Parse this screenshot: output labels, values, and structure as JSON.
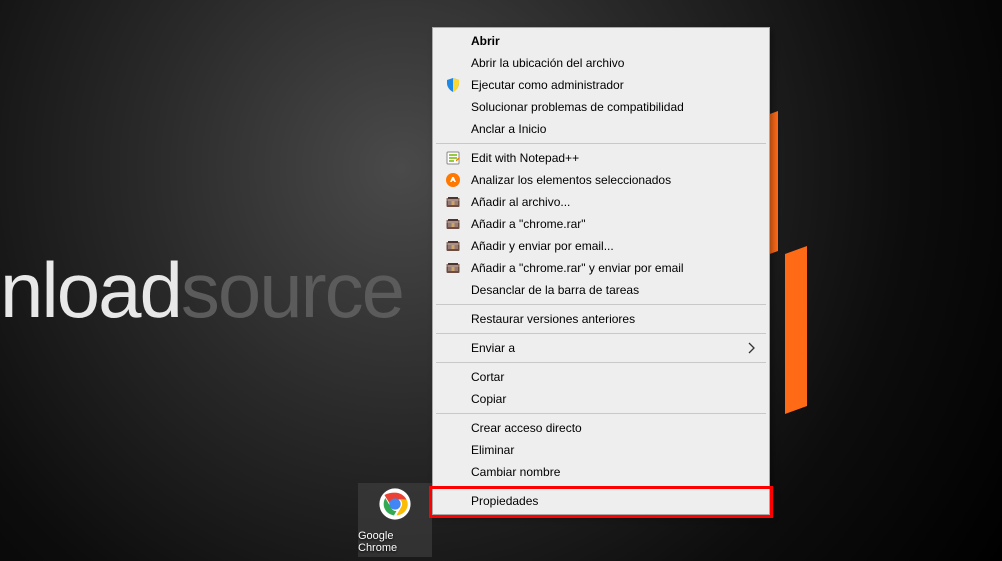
{
  "watermark": {
    "part1": "nload",
    "part2": "source"
  },
  "taskbar_icon": {
    "label": "Google Chrome"
  },
  "menu": {
    "items": [
      {
        "label": "Abrir",
        "bold": true,
        "icon": null
      },
      {
        "label": "Abrir la ubicación del archivo",
        "icon": null
      },
      {
        "label": "Ejecutar como administrador",
        "icon": "shield"
      },
      {
        "label": "Solucionar problemas de compatibilidad",
        "icon": null
      },
      {
        "label": "Anclar a Inicio",
        "icon": null
      },
      {
        "sep": true
      },
      {
        "label": "Edit with Notepad++",
        "icon": "notepad"
      },
      {
        "label": "Analizar los elementos seleccionados",
        "icon": "avast"
      },
      {
        "label": "Añadir al archivo...",
        "icon": "winrar"
      },
      {
        "label": "Añadir a \"chrome.rar\"",
        "icon": "winrar"
      },
      {
        "label": "Añadir y enviar por email...",
        "icon": "winrar"
      },
      {
        "label": "Añadir a \"chrome.rar\" y enviar por email",
        "icon": "winrar"
      },
      {
        "label": "Desanclar de la barra de tareas",
        "icon": null
      },
      {
        "sep": true
      },
      {
        "label": "Restaurar versiones anteriores",
        "icon": null
      },
      {
        "sep": true
      },
      {
        "label": "Enviar a",
        "icon": null,
        "submenu": true
      },
      {
        "sep": true
      },
      {
        "label": "Cortar",
        "icon": null
      },
      {
        "label": "Copiar",
        "icon": null
      },
      {
        "sep": true
      },
      {
        "label": "Crear acceso directo",
        "icon": null
      },
      {
        "label": "Eliminar",
        "icon": null
      },
      {
        "label": "Cambiar nombre",
        "icon": null
      },
      {
        "sep": true
      },
      {
        "label": "Propiedades",
        "icon": null,
        "highlight": true
      }
    ]
  }
}
